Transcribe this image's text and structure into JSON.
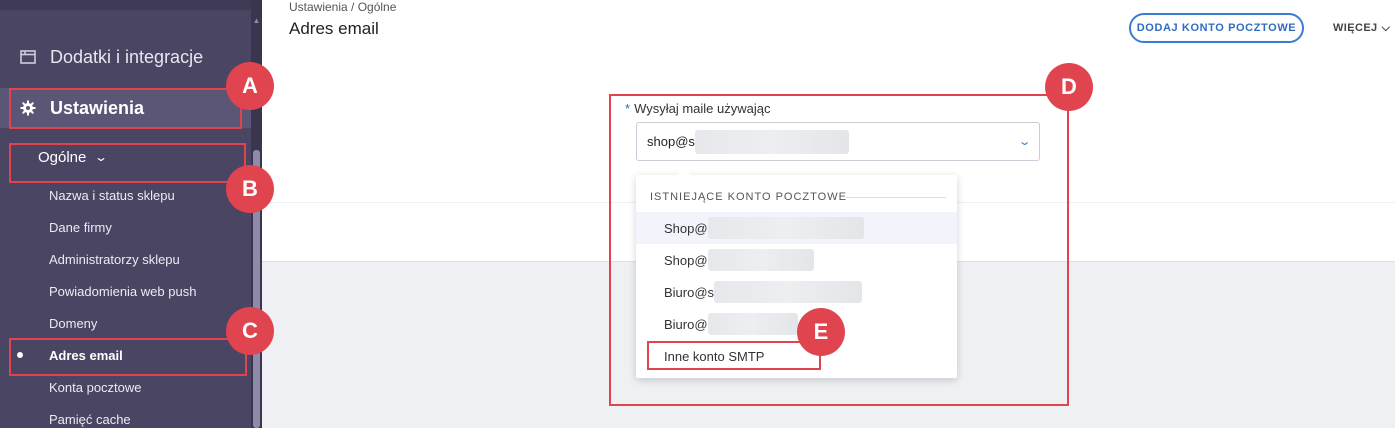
{
  "sidebar": {
    "items": [
      {
        "label": "Dodatki i integracje",
        "icon": "window-icon"
      },
      {
        "label": "Ustawienia",
        "icon": "gear-icon"
      }
    ],
    "submenu": {
      "label": "Ogólne",
      "items": [
        {
          "label": "Nazwa i status sklepu"
        },
        {
          "label": "Dane firmy"
        },
        {
          "label": "Administratorzy sklepu"
        },
        {
          "label": "Powiadomienia web push"
        },
        {
          "label": "Domeny"
        },
        {
          "label": "Adres email"
        },
        {
          "label": "Konta pocztowe"
        },
        {
          "label": "Pamięć cache"
        }
      ],
      "active_label": "Adres email"
    }
  },
  "header": {
    "breadcrumb": "Ustawienia  /  Ogólne",
    "title": "Adres email",
    "add_button": "DODAJ KONTO POCZTOWE",
    "more_label": "WIĘCEJ"
  },
  "form": {
    "required_mark": "*",
    "label": "Wysyłaj maile używając",
    "selected_value": "shop@s"
  },
  "dropdown": {
    "header": "ISTNIEJĄCE KONTO POCZTOWE",
    "options": [
      {
        "label": "Shop@"
      },
      {
        "label": "Shop@"
      },
      {
        "label": "Biuro@s"
      },
      {
        "label": "Biuro@"
      },
      {
        "label": "Inne konto SMTP"
      }
    ]
  },
  "annotations": {
    "A": "A",
    "B": "B",
    "C": "C",
    "D": "D",
    "E": "E",
    "color": "#e0444f"
  },
  "colors": {
    "sidebar": "#4a4563",
    "accent": "#3b7bd4"
  }
}
